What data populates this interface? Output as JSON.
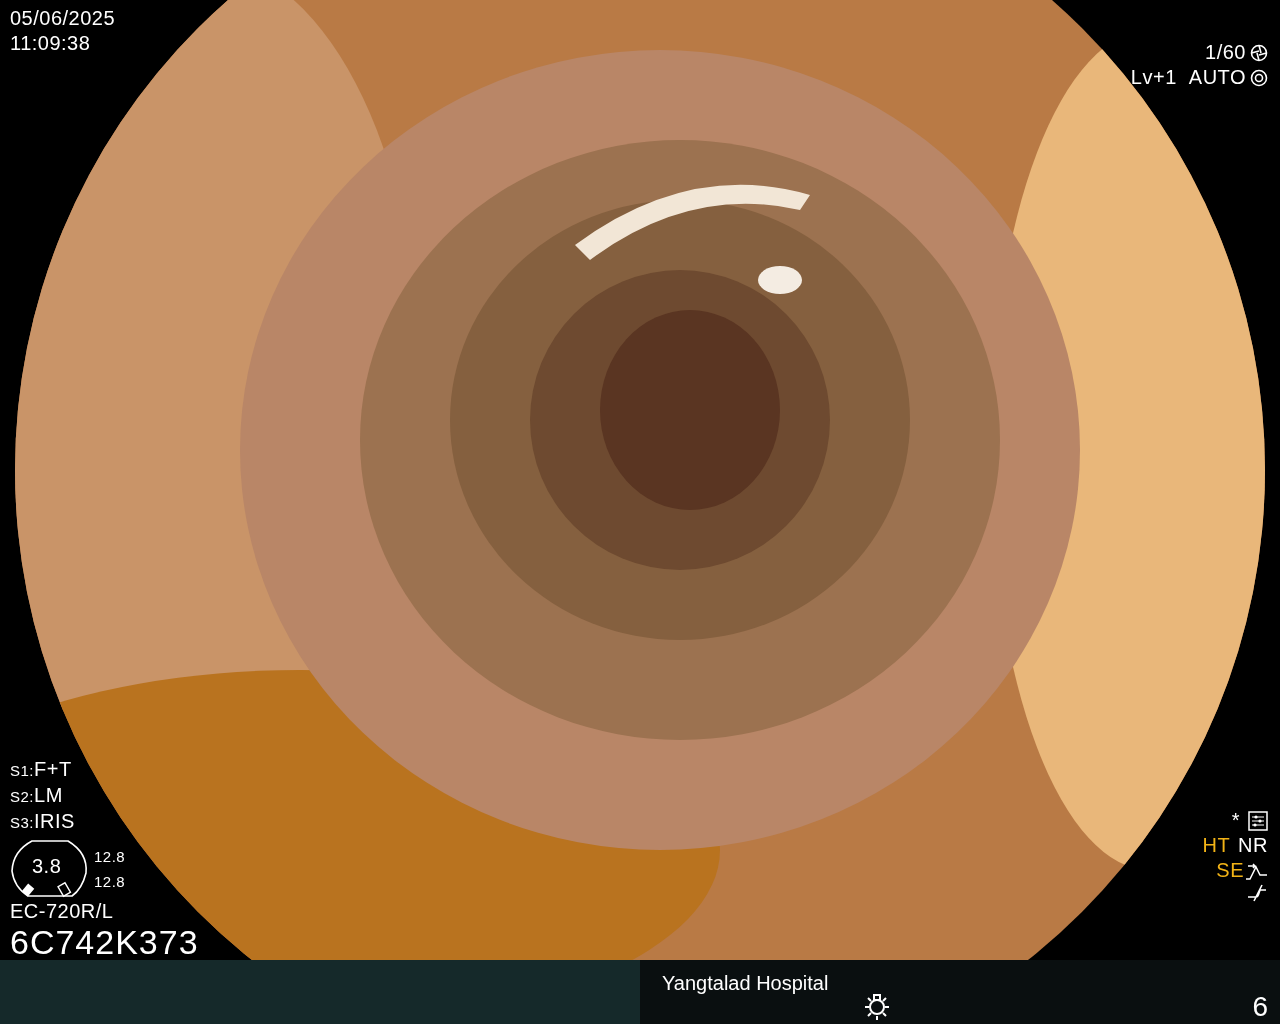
{
  "datetime": {
    "date": "05/06/2025",
    "time": "11:09:38"
  },
  "exposure": {
    "shutter": "1/60",
    "level": "Lv+1",
    "mode": "AUTO"
  },
  "switches": [
    {
      "label": "S1:",
      "value": "F+T"
    },
    {
      "label": "S2:",
      "value": "LM"
    },
    {
      "label": "S3:",
      "value": "IRIS"
    }
  ],
  "gauge": {
    "value": "3.8",
    "readings": [
      "12.8",
      "12.8"
    ]
  },
  "scope": {
    "model": "EC-720R/L",
    "serial": "6C742K373"
  },
  "settings": {
    "marker": "*",
    "flags": [
      {
        "label": "HT",
        "on": true
      },
      {
        "label": "NR",
        "on": false
      },
      {
        "label": "SE",
        "on": true
      }
    ]
  },
  "footer": {
    "hospital": "Yangtalad Hospital",
    "number": "6"
  }
}
